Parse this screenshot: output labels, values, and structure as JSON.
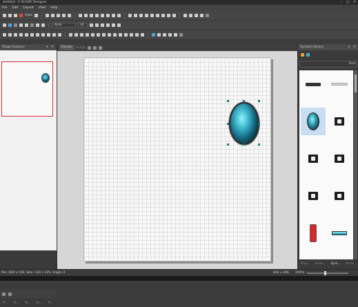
{
  "window": {
    "title": "Untitled - E SCADA Designer"
  },
  "menu": [
    "File",
    "Edit",
    "Layout",
    "View",
    "Help"
  ],
  "toolbar": {
    "start_label": "Start",
    "font_name": "Arial",
    "font_size": "24"
  },
  "left_panel": {
    "title": "Stage Explorer",
    "tabs": [
      "Pr...",
      "St...",
      "To...",
      "Sh...",
      "Ta..."
    ]
  },
  "doc_tabs": [
    "Design",
    "Script"
  ],
  "right_panel": {
    "title": "Symbol Library",
    "find_label": "Find",
    "tabs": [
      "Prop...",
      "Anim...",
      "Sym...",
      "Histo..."
    ]
  },
  "status": {
    "text": "Pos: 620 x 130, Size: 130 x 125, Angle: 0",
    "canvas_size": "844 x 206",
    "zoom": "100%"
  },
  "colors": {
    "selection_handle": "#2ec6d6",
    "explorer_selected_border": "#d23030",
    "library_selected_bg": "#c9def2"
  }
}
